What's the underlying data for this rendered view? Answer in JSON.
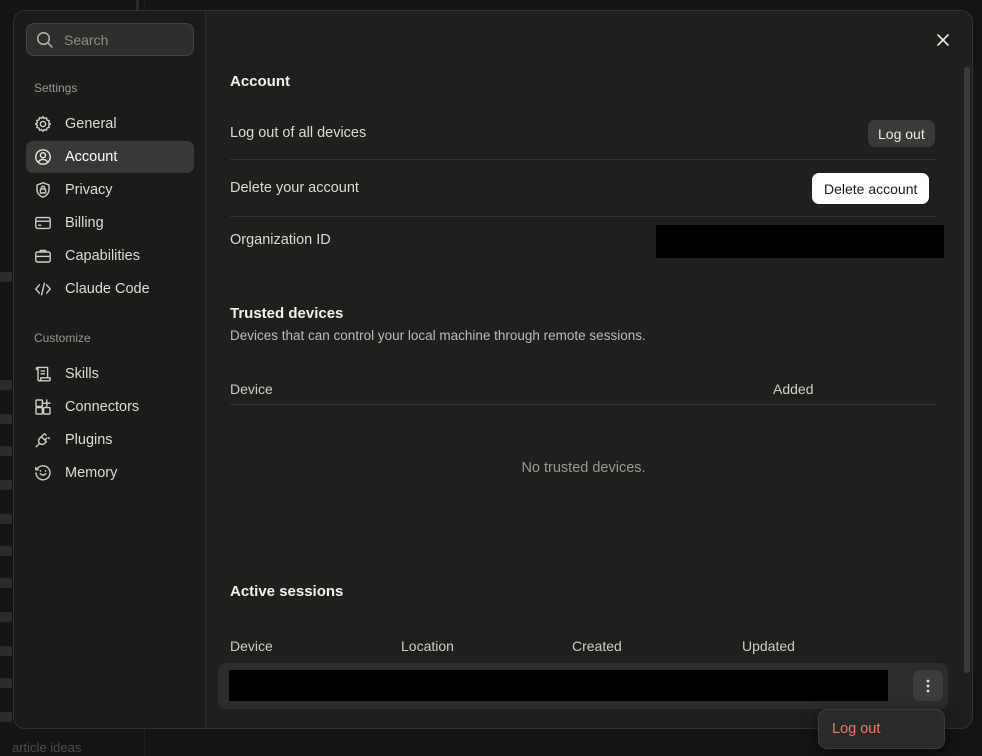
{
  "background": {
    "fragment_text": "article ideas"
  },
  "sidebar": {
    "search_placeholder": "Search",
    "sections": [
      {
        "label": "Settings",
        "items": [
          {
            "label": "General",
            "icon": "gear-icon"
          },
          {
            "label": "Account",
            "icon": "user-circle-icon",
            "active": true
          },
          {
            "label": "Privacy",
            "icon": "shield-lock-icon"
          },
          {
            "label": "Billing",
            "icon": "credit-card-icon"
          },
          {
            "label": "Capabilities",
            "icon": "briefcase-icon"
          },
          {
            "label": "Claude Code",
            "icon": "code-brackets-icon"
          }
        ]
      },
      {
        "label": "Customize",
        "items": [
          {
            "label": "Skills",
            "icon": "scroll-icon"
          },
          {
            "label": "Connectors",
            "icon": "grid-plus-icon"
          },
          {
            "label": "Plugins",
            "icon": "plug-icon"
          },
          {
            "label": "Memory",
            "icon": "memory-icon"
          }
        ]
      }
    ]
  },
  "account": {
    "title": "Account",
    "logout_all_label": "Log out of all devices",
    "logout_button": "Log out",
    "delete_label": "Delete your account",
    "delete_button": "Delete account",
    "org_id_label": "Organization ID"
  },
  "trusted_devices": {
    "title": "Trusted devices",
    "description": "Devices that can control your local machine through remote sessions.",
    "columns": [
      "Device",
      "Added"
    ],
    "empty_text": "No trusted devices."
  },
  "active_sessions": {
    "title": "Active sessions",
    "columns": [
      "Device",
      "Location",
      "Created",
      "Updated"
    ]
  },
  "menu": {
    "logout": "Log out"
  },
  "colors": {
    "accent_danger": "#f07a6a",
    "panel": "#1f1f1e",
    "sidebar": "#1b1b1a",
    "active_item": "#383836"
  }
}
